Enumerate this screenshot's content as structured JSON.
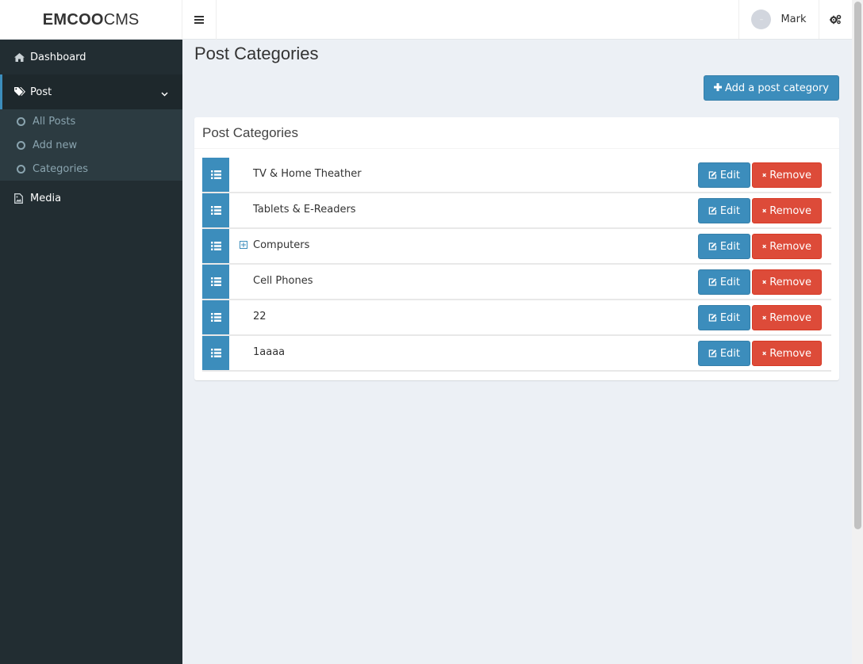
{
  "brand": {
    "bold": "EMCOO",
    "light": "CMS"
  },
  "header": {
    "user_name": "Mark"
  },
  "sidebar": {
    "items": [
      {
        "label": "Dashboard",
        "icon": "home-icon"
      },
      {
        "label": "Post",
        "icon": "tags-icon"
      },
      {
        "label": "Media",
        "icon": "file-image-icon"
      }
    ],
    "post_submenu": [
      {
        "label": "All Posts"
      },
      {
        "label": "Add new"
      },
      {
        "label": "Categories"
      }
    ]
  },
  "page": {
    "title": "Post Categories",
    "add_button": "Add a post category",
    "box_title": "Post Categories"
  },
  "categories": [
    {
      "name": "TV & Home Theather",
      "expandable": false
    },
    {
      "name": "Tablets & E-Readers",
      "expandable": false
    },
    {
      "name": "Computers",
      "expandable": true
    },
    {
      "name": "Cell Phones",
      "expandable": false
    },
    {
      "name": "22",
      "expandable": false
    },
    {
      "name": "1aaaa",
      "expandable": false
    }
  ],
  "actions": {
    "edit": "Edit",
    "remove": "Remove"
  },
  "colors": {
    "primary": "#3c8dbc",
    "danger": "#dd4b39",
    "sidebar": "#222d32"
  }
}
